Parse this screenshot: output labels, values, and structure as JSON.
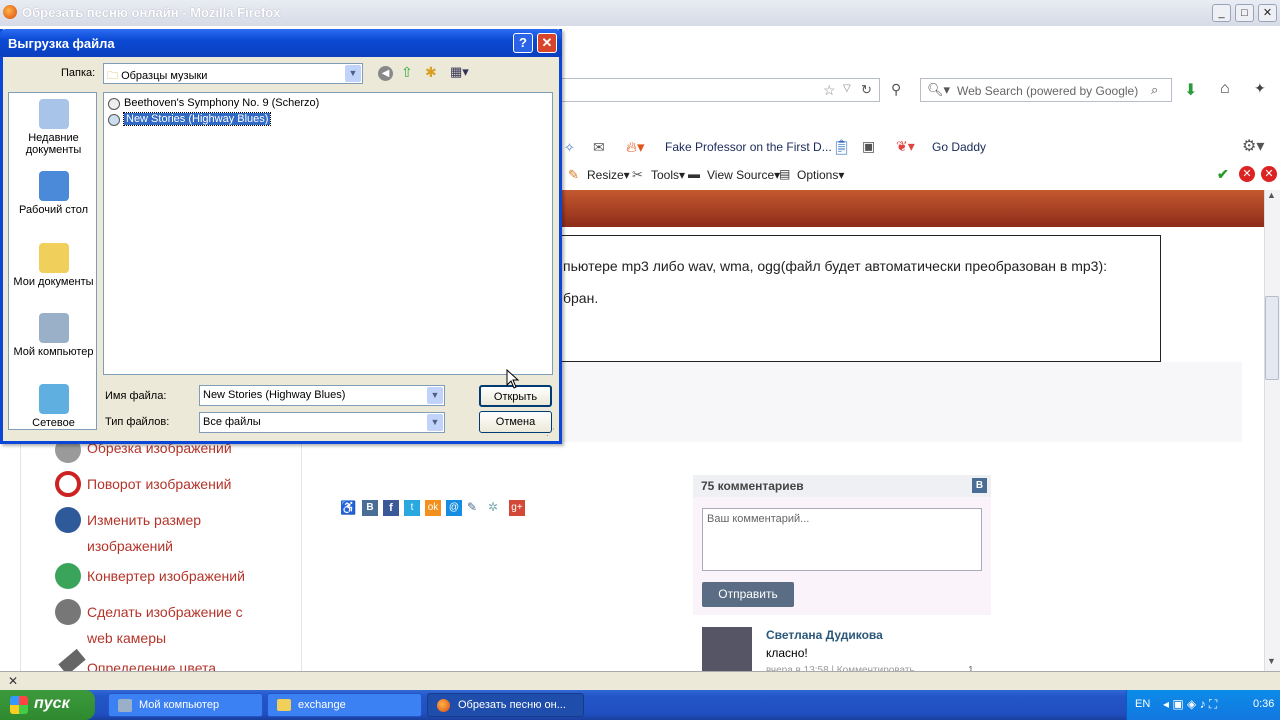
{
  "firefox": {
    "title": "Обрезать песню онлайн - Mozilla Firefox",
    "search_placeholder": "Web Search (powered by Google)",
    "bookmarks": [
      "Fake Professor on the First D...",
      "Go Daddy"
    ],
    "toolbar": [
      "Resize▾",
      "Tools▾",
      "View Source▾",
      "Options▾"
    ]
  },
  "page": {
    "line1": "пьютере mp3 либо wav, wma, ogg(файл будет автоматически преобразован в mp3):",
    "line2": "бран.",
    "sidebar": [
      {
        "label": "Обрезка изображений",
        "icon": "crop-icon"
      },
      {
        "label": "Поворот изображений",
        "icon": "rotate-icon"
      },
      {
        "label": "Изменить размер изображений",
        "icon": "resize-icon"
      },
      {
        "label": "Конвертер изображений",
        "icon": "convert-icon"
      },
      {
        "label": "Сделать изображение с web камеры",
        "icon": "webcam-icon"
      },
      {
        "label": "Определение цвета",
        "icon": "eyedropper-icon"
      }
    ],
    "share_icons": [
      "vk",
      "facebook",
      "twitter",
      "odnoklassniki",
      "mailru",
      "livejournal",
      "liveinternet",
      "google-plus"
    ]
  },
  "comments": {
    "count_label": "75 комментариев",
    "vk_badge": "В",
    "placeholder": "Ваш комментарий...",
    "send_label": "Отправить",
    "author": "Светлана Дудикова",
    "text": "класно!",
    "meta": "вчера в 13:58 | Комментировать",
    "likes": "1"
  },
  "dialog": {
    "title": "Выгрузка файла",
    "folder_label": "Папка:",
    "folder_value": "Образцы музыки",
    "places": [
      {
        "label": "Недавние документы",
        "icon": "recent-icon"
      },
      {
        "label": "Рабочий стол",
        "icon": "desktop-icon"
      },
      {
        "label": "Мои документы",
        "icon": "my-documents-icon"
      },
      {
        "label": "Мой компьютер",
        "icon": "my-computer-icon"
      },
      {
        "label": "Сетевое",
        "icon": "network-icon"
      }
    ],
    "files": [
      "Beethoven's Symphony No. 9 (Scherzo)",
      "New Stories (Highway Blues)"
    ],
    "filename_label": "Имя файла:",
    "filename_value": "New Stories (Highway Blues)",
    "filetype_label": "Тип файлов:",
    "filetype_value": "Все файлы",
    "open_label": "Открыть",
    "cancel_label": "Отмена"
  },
  "taskbar": {
    "start": "пуск",
    "tasks": [
      "Мой компьютер",
      "exchange",
      "Обрезать песню он..."
    ],
    "lang": "EN",
    "clock": "0:36"
  },
  "colors": {
    "xp_blue": "#0a47d8",
    "accent_red": "#b4342a",
    "selection": "#316ac5"
  }
}
